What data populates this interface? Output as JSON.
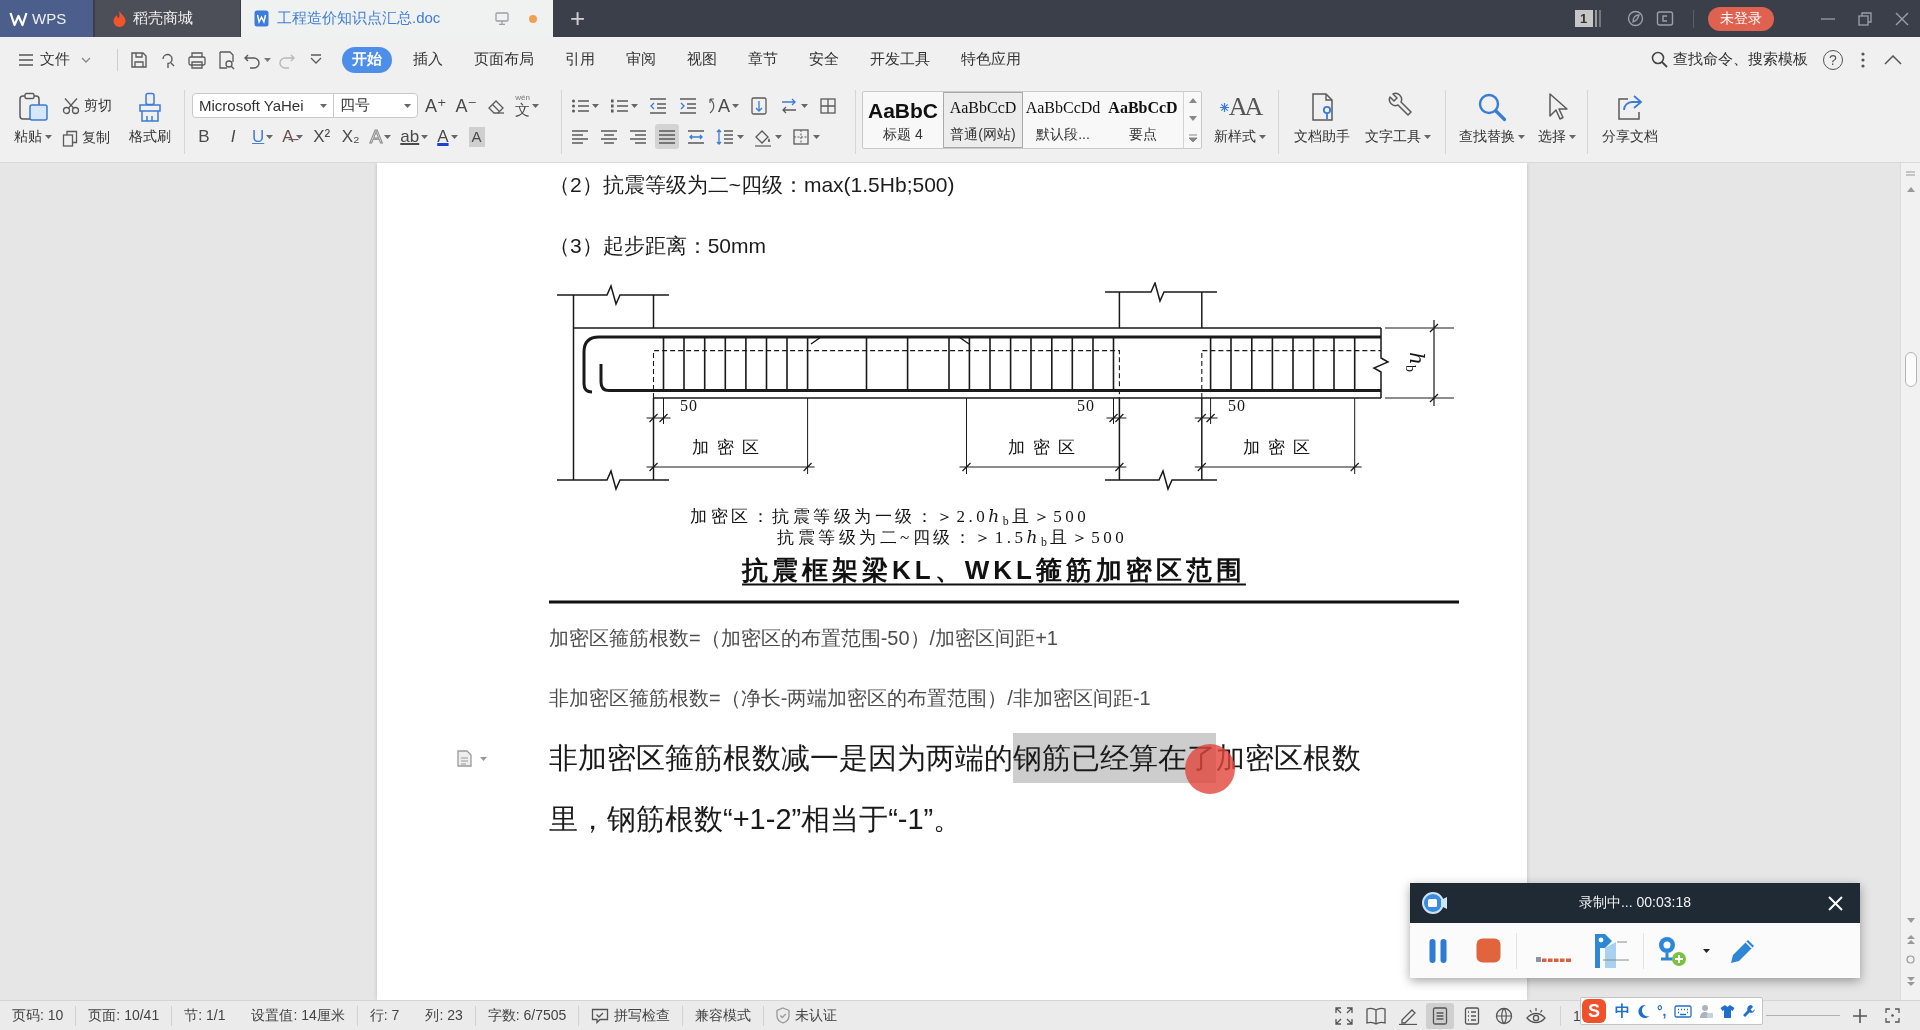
{
  "title_bar": {
    "tabs": [
      {
        "kind": "app",
        "label": "WPS",
        "selected": false,
        "unsaved": false
      },
      {
        "kind": "store",
        "label": "稻壳商城",
        "selected": false,
        "unsaved": false
      },
      {
        "kind": "document",
        "label": "工程造价知识点汇总.doc",
        "selected": true,
        "unsaved": true
      }
    ],
    "new_tab": "+",
    "window_badge": "1",
    "login_button": "未登录"
  },
  "menu_bar": {
    "file_menu": "文件",
    "tabs": [
      {
        "label": "开始",
        "selected": true
      },
      {
        "label": "插入",
        "selected": false
      },
      {
        "label": "页面布局",
        "selected": false
      },
      {
        "label": "引用",
        "selected": false
      },
      {
        "label": "审阅",
        "selected": false
      },
      {
        "label": "视图",
        "selected": false
      },
      {
        "label": "章节",
        "selected": false
      },
      {
        "label": "安全",
        "selected": false
      },
      {
        "label": "开发工具",
        "selected": false
      },
      {
        "label": "特色应用",
        "selected": false
      }
    ],
    "search_button": "查找命令、搜索模板",
    "help": "?"
  },
  "ribbon": {
    "clipboard": [
      {
        "kind": "paste",
        "label": "粘贴",
        "dropdown": true
      },
      {
        "kind": "cut",
        "label": "剪切",
        "dropdown": false
      },
      {
        "kind": "copy",
        "label": "复制",
        "dropdown": false
      },
      {
        "kind": "brush",
        "label": "格式刷",
        "dropdown": false
      }
    ],
    "font": {
      "font_name": "Microsoft YaHei",
      "font_size": "四号",
      "row_1": [
        {
          "kind": "grow",
          "glyph": "A⁺",
          "dropdown": false
        },
        {
          "kind": "shrink",
          "glyph": "A⁻",
          "dropdown": false
        },
        {
          "kind": "eraser",
          "dropdown": false
        },
        {
          "kind": "pinyin",
          "glyph": "文",
          "ruby": "wén",
          "dropdown": true
        }
      ],
      "row_2": [
        {
          "kind": "bold",
          "glyph": "B",
          "dropdown": false
        },
        {
          "kind": "italic",
          "glyph": "I",
          "dropdown": false
        },
        {
          "kind": "underline",
          "glyph": "U",
          "dropdown": true
        },
        {
          "kind": "strike",
          "glyph": "A̶",
          "dropdown": true
        },
        {
          "kind": "superscript",
          "glyph": "X²",
          "dropdown": false
        },
        {
          "kind": "subscript",
          "glyph": "X₂",
          "dropdown": false
        },
        {
          "kind": "outline",
          "glyph": "A",
          "dropdown": true
        },
        {
          "kind": "highlight",
          "glyph": "ab",
          "dropdown": true
        },
        {
          "kind": "color",
          "glyph": "A",
          "dropdown": true
        },
        {
          "kind": "shade",
          "glyph": "A",
          "dropdown": false
        }
      ]
    },
    "paragraph": {
      "row_1": [
        {
          "kind": "bullets",
          "dropdown": true
        },
        {
          "kind": "numbering",
          "dropdown": true
        },
        {
          "kind": "outdent",
          "dropdown": false
        },
        {
          "kind": "indent",
          "dropdown": false
        },
        {
          "kind": "direction",
          "glyph": "A",
          "dropdown": true
        },
        {
          "kind": "sort",
          "dropdown": false
        },
        {
          "kind": "swap",
          "dropdown": true
        },
        {
          "kind": "table",
          "dropdown": false
        }
      ],
      "alignment": [
        {
          "kind": "align_left",
          "selected": false
        },
        {
          "kind": "align_center",
          "selected": false
        },
        {
          "kind": "align_right",
          "selected": false
        },
        {
          "kind": "justify",
          "selected": true
        },
        {
          "kind": "distribute",
          "selected": false
        }
      ],
      "spacing": [
        {
          "kind": "line_spacing",
          "dropdown": true
        },
        {
          "kind": "shading",
          "dropdown": true
        },
        {
          "kind": "border",
          "dropdown": true
        }
      ]
    },
    "styles": {
      "items": [
        {
          "kind": "heading",
          "preview": "AaBbC",
          "label": "标题 4",
          "selected": false
        },
        {
          "kind": "normal",
          "preview": "AaBbCcD",
          "label": "普通(网站)",
          "selected": true
        },
        {
          "kind": "normal",
          "preview": "AaBbCcDd",
          "label": "默认段...",
          "selected": false
        },
        {
          "kind": "strong",
          "preview": "AaBbCcD",
          "label": "要点",
          "selected": false
        }
      ],
      "new_style": {
        "glyph": "AA",
        "label": "新样式",
        "dropdown": true
      }
    },
    "tools": [
      {
        "kind": "assistant",
        "label": "文档助手",
        "dropdown": false
      },
      {
        "kind": "text_tools",
        "label": "文字工具",
        "dropdown": true
      }
    ],
    "find": [
      {
        "kind": "find_replace",
        "label": "查找替换",
        "dropdown": true
      },
      {
        "kind": "select",
        "label": "选择",
        "dropdown": true
      }
    ],
    "share": {
      "label": "分享文档"
    }
  },
  "document": {
    "blocks": [
      {
        "kind": "line",
        "text": "（2）抗震等级为二~四级：max(1.5Hb;500)"
      },
      {
        "kind": "line",
        "text": "（3）起步距离：50mm"
      },
      {
        "kind": "figure",
        "dimension_labels": [
          "50",
          "50",
          "50"
        ],
        "zone_labels": [
          "加密区",
          "加密区",
          "加密区"
        ],
        "height_label": "ℎ$_{b}$",
        "legend": [
          "加密区：抗震等级为一级：＞2.0ℎ$_{b}$且＞500",
          "抗震等级为二~四级：＞1.5ℎ$_{b}$且＞500"
        ],
        "caption": "抗震框架梁KL、WKL箍筋加密区范围"
      },
      {
        "kind": "formula",
        "text": "加密区箍筋根数=（加密区的布置范围-50）/加密区间距+1"
      },
      {
        "kind": "formula",
        "text": "非加密区箍筋根数=（净长-两端加密区的布置范围）/非加密区间距-1"
      },
      {
        "kind": "note",
        "segments": [
          {
            "text": "非加密区箍筋根数减一是因为两端的",
            "selected": false
          },
          {
            "text": "钢筋已经算在了",
            "selected": true
          },
          {
            "text": "加密区根数里，钢筋根数“+1-2”相当于“-1”。",
            "selected": false
          }
        ]
      }
    ]
  },
  "status_bar": {
    "fields": [
      [
        "页码: 10"
      ],
      [
        "页面: 10/41"
      ],
      [
        "节: 1/1",
        "设置值: 14厘米"
      ],
      [
        "行: 7",
        "列: 23"
      ],
      [
        "字数: 6/7505"
      ]
    ],
    "buttons": [
      {
        "kind": "spell",
        "label": "拼写检查"
      },
      {
        "kind": "compat",
        "label": "兼容模式"
      },
      {
        "kind": "cert",
        "label": "未认证"
      }
    ],
    "view_modes": [
      {
        "kind": "fullscreen",
        "selected": false
      },
      {
        "kind": "read",
        "selected": false
      },
      {
        "kind": "write",
        "selected": false
      },
      {
        "kind": "page",
        "selected": true
      },
      {
        "kind": "outline",
        "selected": false
      },
      {
        "kind": "web",
        "selected": false
      },
      {
        "kind": "eye",
        "selected": false
      }
    ],
    "zoom_value": "1"
  },
  "ime_bar": {
    "logo": "S",
    "mode": "中",
    "punctuation": "°,"
  },
  "recorder": {
    "title": "录制中... 00:03:18",
    "recording": true
  }
}
